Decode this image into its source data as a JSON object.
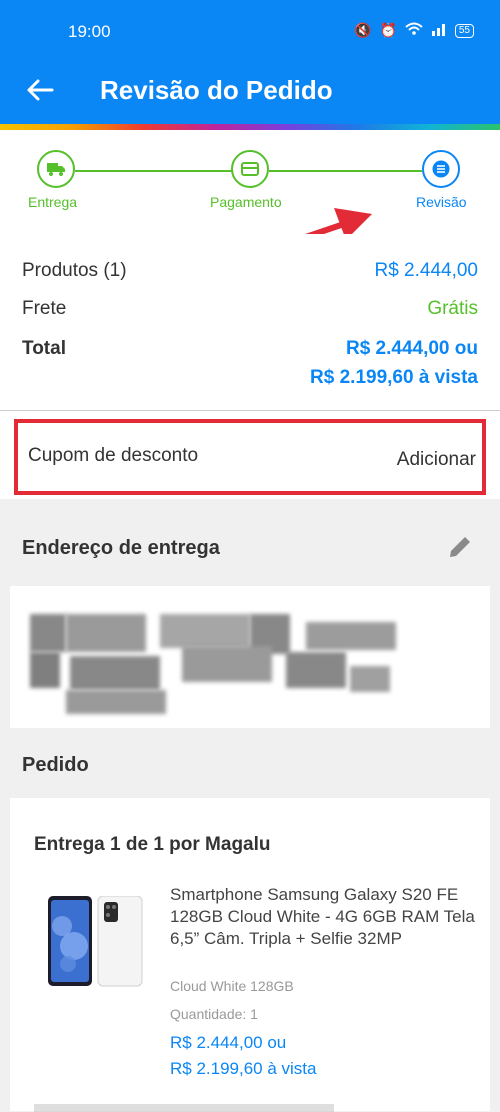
{
  "status_bar": {
    "time": "19:00",
    "battery": "55"
  },
  "header": {
    "title": "Revisão do Pedido"
  },
  "stepper": {
    "steps": [
      {
        "label": "Entrega"
      },
      {
        "label": "Pagamento"
      },
      {
        "label": "Revisão"
      }
    ]
  },
  "summary": {
    "products_label": "Produtos (1)",
    "products_value": "R$ 2.444,00",
    "shipping_label": "Frete",
    "shipping_value": "Grátis",
    "total_label": "Total",
    "total_value_line1": "R$ 2.444,00 ou",
    "total_value_line2": "R$ 2.199,60 à vista"
  },
  "coupon": {
    "label": "Cupom de desconto",
    "action": "Adicionar"
  },
  "address": {
    "title": "Endereço de entrega"
  },
  "order": {
    "title": "Pedido",
    "delivery_title": "Entrega 1 de 1 por Magalu",
    "product": {
      "name": "Smartphone Samsung Galaxy S20 FE 128GB Cloud White - 4G 6GB RAM Tela 6,5” Câm. Tripla + Selfie 32MP",
      "variant": "Cloud White 128GB",
      "quantity": "Quantidade:  1",
      "price_line1": "R$ 2.444,00 ou",
      "price_line2": "R$ 2.199,60 à vista"
    }
  },
  "colors": {
    "primary": "#0a86f5",
    "success": "#56c02b",
    "highlight": "#e22b36"
  }
}
